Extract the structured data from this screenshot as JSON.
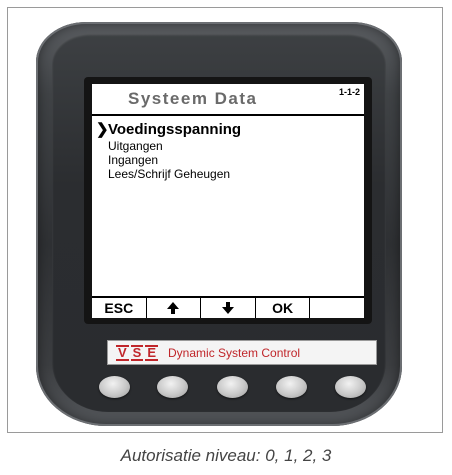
{
  "screen": {
    "title": "Systeem Data",
    "page_id": "1-1-2",
    "cursor": "❯",
    "menu": [
      {
        "label": "Voedingsspanning",
        "selected": true
      },
      {
        "label": "Uitgangen",
        "selected": false
      },
      {
        "label": "Ingangen",
        "selected": false
      },
      {
        "label": "Lees/Schrijf Geheugen",
        "selected": false
      }
    ],
    "softkeys": {
      "key1": "ESC",
      "key2_icon": "arrow-up-icon",
      "key3_icon": "arrow-down-icon",
      "key4": "OK",
      "key5": ""
    }
  },
  "brand": {
    "logo_letters": [
      "V",
      "S",
      "E"
    ],
    "text": "Dynamic System Control",
    "color": "#c0262a"
  },
  "caption": "Autorisatie niveau: 0, 1, 2, 3"
}
